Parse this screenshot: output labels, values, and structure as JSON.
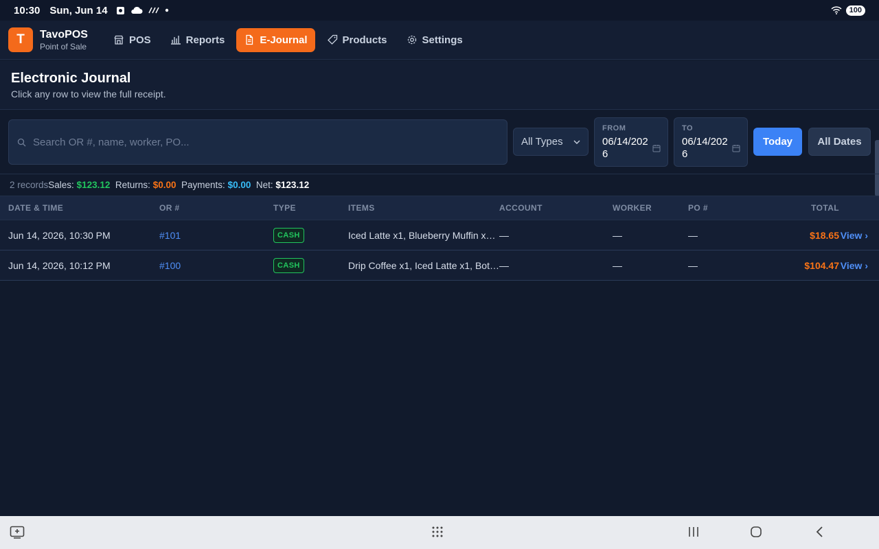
{
  "status_bar": {
    "time": "10:30",
    "date": "Sun, Jun 14",
    "battery": "100"
  },
  "brand": {
    "logo_letter": "T",
    "name": "TavoPOS",
    "subtitle": "Point of Sale"
  },
  "nav": [
    {
      "label": "POS",
      "icon": "store-icon",
      "active": false
    },
    {
      "label": "Reports",
      "icon": "bar-chart-icon",
      "active": false
    },
    {
      "label": "E-Journal",
      "icon": "document-icon",
      "active": true
    },
    {
      "label": "Products",
      "icon": "tag-icon",
      "active": false
    },
    {
      "label": "Settings",
      "icon": "gear-icon",
      "active": false
    }
  ],
  "header": {
    "title": "Electronic Journal",
    "subtitle": "Click any row to view the full receipt."
  },
  "filters": {
    "search_placeholder": "Search OR #, name, worker, PO...",
    "type_select": "All Types",
    "from_label": "FROM",
    "from_value": "06/14/2026",
    "to_label": "TO",
    "to_value": "06/14/2026",
    "today_button": "Today",
    "all_dates_button": "All Dates"
  },
  "summary": {
    "records": "2 records",
    "sales_label": "Sales:",
    "sales_value": "$123.12",
    "returns_label": "Returns:",
    "returns_value": "$0.00",
    "payments_label": "Payments:",
    "payments_value": "$0.00",
    "net_label": "Net:",
    "net_value": "$123.12"
  },
  "table": {
    "columns": [
      "DATE & TIME",
      "OR #",
      "TYPE",
      "ITEMS",
      "ACCOUNT",
      "WORKER",
      "PO #",
      "TOTAL"
    ],
    "rows": [
      {
        "datetime": "Jun 14, 2026, 10:30 PM",
        "or": "#101",
        "type": "CASH",
        "items": "Iced Latte x1, Blueberry Muffin x1, ...",
        "account": "—",
        "worker": "—",
        "po": "—",
        "total": "$18.65",
        "view": "View ›"
      },
      {
        "datetime": "Jun 14, 2026, 10:12 PM",
        "or": "#100",
        "type": "CASH",
        "items": "Drip Coffee x1, Iced Latte x1, Bottl...",
        "account": "—",
        "worker": "—",
        "po": "—",
        "total": "$104.47",
        "view": "View ›"
      }
    ]
  },
  "colors": {
    "accent": "#f46a1b",
    "primary": "#3b82f6",
    "background": "#111a2c",
    "positive": "#22c55e"
  }
}
